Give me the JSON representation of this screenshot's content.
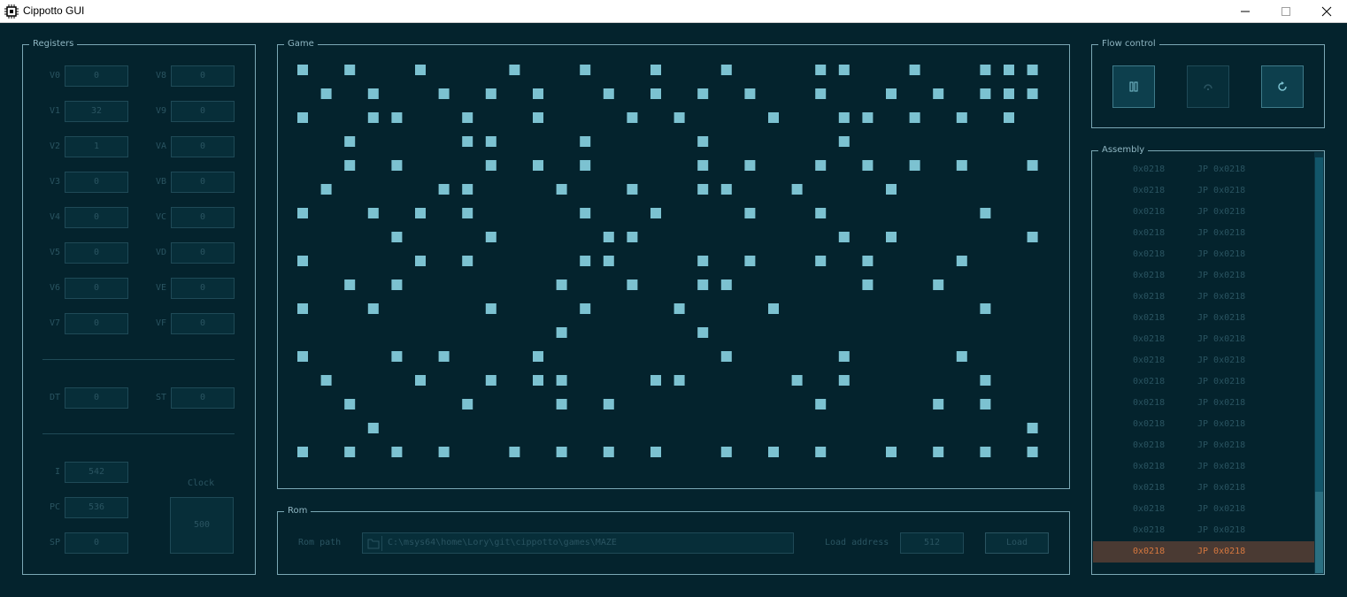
{
  "window": {
    "title": "Cippotto GUI"
  },
  "colors": {
    "background": "#04232d",
    "pixel_on": "#7cc2d1",
    "accent": "#d6783f",
    "border": "#7ba8b5"
  },
  "registers": {
    "label": "Registers",
    "left": [
      {
        "name": "V0",
        "value": "0"
      },
      {
        "name": "V1",
        "value": "32"
      },
      {
        "name": "V2",
        "value": "1"
      },
      {
        "name": "V3",
        "value": "0"
      },
      {
        "name": "V4",
        "value": "0"
      },
      {
        "name": "V5",
        "value": "0"
      },
      {
        "name": "V6",
        "value": "0"
      },
      {
        "name": "V7",
        "value": "0"
      }
    ],
    "right": [
      {
        "name": "V8",
        "value": "0"
      },
      {
        "name": "V9",
        "value": "0"
      },
      {
        "name": "VA",
        "value": "0"
      },
      {
        "name": "VB",
        "value": "0"
      },
      {
        "name": "VC",
        "value": "0"
      },
      {
        "name": "VD",
        "value": "0"
      },
      {
        "name": "VE",
        "value": "0"
      },
      {
        "name": "VF",
        "value": "0"
      }
    ],
    "dt": {
      "name": "DT",
      "value": "0"
    },
    "st": {
      "name": "ST",
      "value": "0"
    },
    "i": {
      "name": "I",
      "value": "542"
    },
    "pc": {
      "name": "PC",
      "value": "536"
    },
    "sp": {
      "name": "SP",
      "value": "0"
    },
    "clock": {
      "label": "Clock",
      "value": "500"
    }
  },
  "game": {
    "label": "Game",
    "width": 32,
    "height": 17,
    "rows": [
      "10100100010010010010001100100111",
      "01010010101001010101001001010111",
      "10011001001000101000100110101010",
      "00100001100010000100000100000000",
      "00101000101010000101001010101001",
      "01000011000100100110010001000000",
      "10010101000010010001001000000100",
      "00001000100001100000000101000001",
      "10000101000011000101001010001000",
      "00101000000100100110000010010000",
      "10010000100010001000100000000100",
      "00000000000100000100000000000000",
      "10001010001000000010000100001000",
      "01000100101100011000010100000100",
      "00100001000101000000001000010100",
      "00010000000000000000000000000001",
      "10101010010101010010101001010101"
    ]
  },
  "rom": {
    "label": "Rom",
    "path_label": "Rom path",
    "path": "C:\\msys64\\home\\Lory\\git\\cippotto\\games\\MAZE",
    "load_address_label": "Load address",
    "load_address": "512",
    "load_button": "Load"
  },
  "flow": {
    "label": "Flow control",
    "buttons": [
      "pause-icon",
      "step-icon",
      "reset-icon"
    ]
  },
  "assembly": {
    "label": "Assembly",
    "rows": [
      {
        "addr": "0x0218",
        "ins": "JP 0x0218"
      },
      {
        "addr": "0x0218",
        "ins": "JP 0x0218"
      },
      {
        "addr": "0x0218",
        "ins": "JP 0x0218"
      },
      {
        "addr": "0x0218",
        "ins": "JP 0x0218"
      },
      {
        "addr": "0x0218",
        "ins": "JP 0x0218"
      },
      {
        "addr": "0x0218",
        "ins": "JP 0x0218"
      },
      {
        "addr": "0x0218",
        "ins": "JP 0x0218"
      },
      {
        "addr": "0x0218",
        "ins": "JP 0x0218"
      },
      {
        "addr": "0x0218",
        "ins": "JP 0x0218"
      },
      {
        "addr": "0x0218",
        "ins": "JP 0x0218"
      },
      {
        "addr": "0x0218",
        "ins": "JP 0x0218"
      },
      {
        "addr": "0x0218",
        "ins": "JP 0x0218"
      },
      {
        "addr": "0x0218",
        "ins": "JP 0x0218"
      },
      {
        "addr": "0x0218",
        "ins": "JP 0x0218"
      },
      {
        "addr": "0x0218",
        "ins": "JP 0x0218"
      },
      {
        "addr": "0x0218",
        "ins": "JP 0x0218"
      },
      {
        "addr": "0x0218",
        "ins": "JP 0x0218"
      },
      {
        "addr": "0x0218",
        "ins": "JP 0x0218"
      },
      {
        "addr": "0x0218",
        "ins": "JP 0x0218"
      },
      {
        "addr": "0x0218",
        "ins": "JP 0x0218"
      }
    ],
    "active_index": 19
  }
}
